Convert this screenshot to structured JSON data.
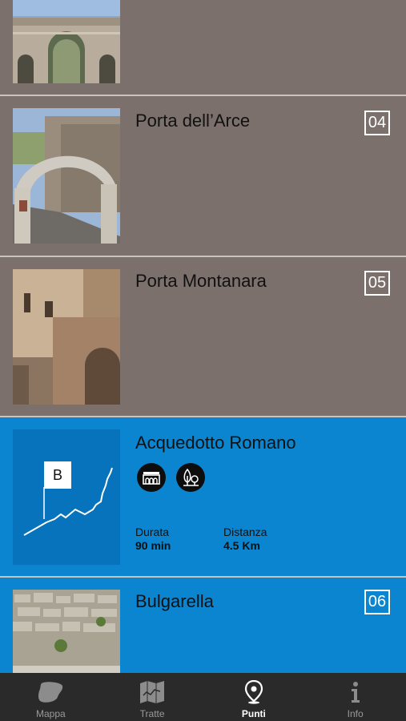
{
  "items": [
    {
      "title": "",
      "number": ""
    },
    {
      "title": "Porta dell’Arce",
      "number": "04"
    },
    {
      "title": "Porta Montanara",
      "number": "05"
    },
    {
      "title": "Acquedotto Romano",
      "marker": "B",
      "duration_label": "Durata",
      "duration_value": "90 min",
      "distance_label": "Distanza",
      "distance_value": "4.5 Km",
      "icons": [
        "aqueduct-icon",
        "trees-icon"
      ]
    },
    {
      "title": "Bulgarella",
      "number": "06"
    }
  ],
  "tabbar": {
    "tabs": [
      {
        "label": "Mappa",
        "icon": "map-shape-icon"
      },
      {
        "label": "Tratte",
        "icon": "folded-map-icon"
      },
      {
        "label": "Punti",
        "icon": "location-pin-icon",
        "active": true
      },
      {
        "label": "Info",
        "icon": "info-icon"
      }
    ]
  },
  "colors": {
    "gray_row": "#7b706c",
    "blue_row": "#0b85cf",
    "tabbar": "#2a2a2a"
  }
}
